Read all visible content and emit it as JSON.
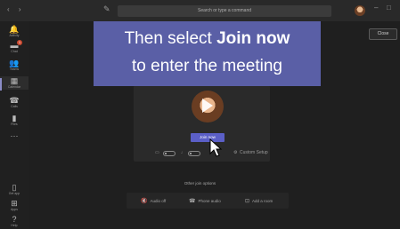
{
  "titlebar": {
    "nav_arrows": "‹ ›",
    "search_placeholder": "Search or type a command"
  },
  "sidebar": {
    "items": [
      {
        "label": "Activity",
        "icon": "bell-icon",
        "glyph": "🔔"
      },
      {
        "label": "Chat",
        "icon": "chat-icon",
        "glyph": "▬",
        "badge": "1"
      },
      {
        "label": "Teams",
        "icon": "teams-icon",
        "glyph": "👥"
      },
      {
        "label": "Calendar",
        "icon": "calendar-icon",
        "glyph": "▦"
      },
      {
        "label": "Calls",
        "icon": "phone-icon",
        "glyph": "☎"
      },
      {
        "label": "Files",
        "icon": "file-icon",
        "glyph": "▮"
      },
      {
        "label": "",
        "icon": "more-icon",
        "glyph": "···"
      }
    ],
    "bottom": [
      {
        "label": "Get app",
        "icon": "device-icon",
        "glyph": "▯"
      },
      {
        "label": "Apps",
        "icon": "apps-icon",
        "glyph": "⊞"
      },
      {
        "label": "Help",
        "icon": "help-icon",
        "glyph": "?"
      }
    ]
  },
  "close_button": "Close",
  "overlay": {
    "line1_prefix": "Then select ",
    "line1_bold": "Join now",
    "line2": "to enter the meeting"
  },
  "preview": {
    "join_button": "Join now",
    "custom_setup": "Custom Setup"
  },
  "other_join": {
    "title": "Other join options",
    "options": [
      {
        "label": "Audio off",
        "icon": "speaker-off-icon",
        "glyph": "🔇"
      },
      {
        "label": "Phone audio",
        "icon": "phone-icon",
        "glyph": "☎"
      },
      {
        "label": "Add a room",
        "icon": "room-icon",
        "glyph": "⊡"
      }
    ]
  },
  "colors": {
    "accent": "#5b5fc7",
    "overlay": "#5a5fa6",
    "background": "#1f1f1f"
  }
}
